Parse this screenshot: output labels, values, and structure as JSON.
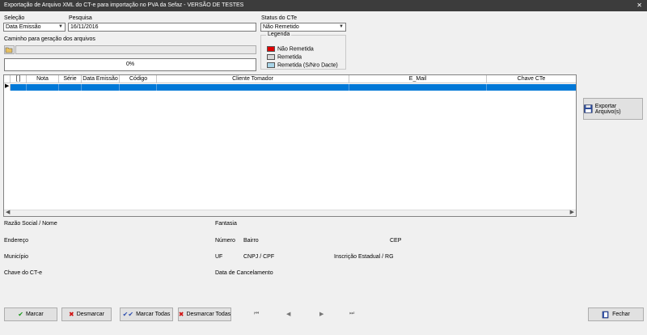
{
  "window": {
    "title": "Exportação de Arquivo XML do CT-e para importação no PVA da Sefaz - VERSÃO DE TESTES",
    "close": "✕"
  },
  "filters": {
    "selecao_label": "Seleção",
    "selecao_value": "Data Emissão",
    "pesquisa_label": "Pesquisa",
    "pesquisa_value": "16/11/2016",
    "status_label": "Status do CTe",
    "status_value": "Não Remetido",
    "caminho_label": "Caminho para geração dos arquivos",
    "progress_text": "0%",
    "progress": 0
  },
  "legend": {
    "title": "Legenda",
    "items": [
      {
        "label": "Não Remetida",
        "color": "#e00000"
      },
      {
        "label": "Remetida",
        "color": "#d8d8d8"
      },
      {
        "label": "Remetida (S/Nro Dacte)",
        "color": "#a8d4e8"
      }
    ]
  },
  "grid": {
    "columns": [
      "[ ]",
      "Nota",
      "Série",
      "Data Emissão",
      "Código",
      "Cliente Tomador",
      "E_Mail",
      "Chave CTe"
    ],
    "row_indicator": "▶",
    "selection_color": "#0078d7"
  },
  "details": {
    "razao": "Razão Social / Nome",
    "fantasia": "Fantasia",
    "endereco": "Endereço",
    "numero": "Número",
    "bairro": "Bairro",
    "cep": "CEP",
    "municipio": "Município",
    "uf": "UF",
    "cnpj": "CNPJ / CPF",
    "inscricao": "Inscrição Estadual / RG",
    "chave": "Chave do CT-e",
    "data_cancel": "Data de Cancelamento"
  },
  "buttons": {
    "exportar": "Exportar Arquivo(s)",
    "marcar": "Marcar",
    "desmarcar": "Desmarcar",
    "marcar_todas": "Marcar Todas",
    "desmarcar_todas": "Desmarcar Todas",
    "fechar": "Fechar"
  },
  "nav": {
    "first": "⏮",
    "prev": "◀",
    "next": "▶",
    "last": "⏭"
  }
}
